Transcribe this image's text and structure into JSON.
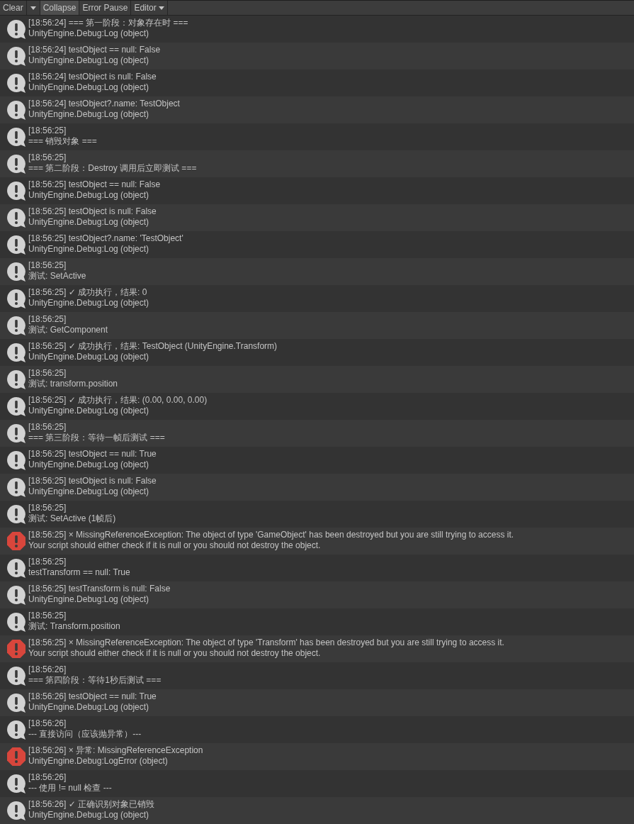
{
  "toolbar": {
    "items": [
      {
        "kind": "split",
        "label": "Clear"
      },
      {
        "kind": "toggle",
        "label": "Collapse",
        "on": true
      },
      {
        "kind": "toggle",
        "label": "Error Pause",
        "on": false
      },
      {
        "kind": "dropdown",
        "label": "Editor"
      }
    ]
  },
  "entries": [
    {
      "kind": "log",
      "line_1": "[18:56:24] === 第一阶段：对象存在时 ===",
      "line_2": "UnityEngine.Debug:Log (object)"
    },
    {
      "kind": "log",
      "line_1": "[18:56:24] testObject == null: False",
      "line_2": "UnityEngine.Debug:Log (object)"
    },
    {
      "kind": "log",
      "line_1": "[18:56:24] testObject is null: False",
      "line_2": "UnityEngine.Debug:Log (object)"
    },
    {
      "kind": "log",
      "line_1": "[18:56:24] testObject?.name: TestObject",
      "line_2": "UnityEngine.Debug:Log (object)"
    },
    {
      "kind": "log",
      "line_1": "[18:56:25]",
      "line_2": "=== 销毁对象 ==="
    },
    {
      "kind": "log",
      "line_1": "[18:56:25]",
      "line_2": "=== 第二阶段：Destroy 调用后立即测试 ==="
    },
    {
      "kind": "log",
      "line_1": "[18:56:25] testObject == null: False",
      "line_2": "UnityEngine.Debug:Log (object)"
    },
    {
      "kind": "log",
      "line_1": "[18:56:25] testObject is null: False",
      "line_2": "UnityEngine.Debug:Log (object)"
    },
    {
      "kind": "log",
      "line_1": "[18:56:25] testObject?.name: 'TestObject'",
      "line_2": "UnityEngine.Debug:Log (object)"
    },
    {
      "kind": "log",
      "line_1": "[18:56:25]",
      "line_2": "测试: SetActive"
    },
    {
      "kind": "log",
      "line_1": "[18:56:25] ✓ 成功执行，结果: 0",
      "line_2": "UnityEngine.Debug:Log (object)"
    },
    {
      "kind": "log",
      "line_1": "[18:56:25]",
      "line_2": "测试: GetComponent"
    },
    {
      "kind": "log",
      "line_1": "[18:56:25] ✓ 成功执行，结果: TestObject (UnityEngine.Transform)",
      "line_2": "UnityEngine.Debug:Log (object)"
    },
    {
      "kind": "log",
      "line_1": "[18:56:25]",
      "line_2": "测试: transform.position"
    },
    {
      "kind": "log",
      "line_1": "[18:56:25] ✓ 成功执行，结果: (0.00, 0.00, 0.00)",
      "line_2": "UnityEngine.Debug:Log (object)"
    },
    {
      "kind": "log",
      "line_1": "[18:56:25]",
      "line_2": "=== 第三阶段：等待一帧后测试 ==="
    },
    {
      "kind": "log",
      "line_1": "[18:56:25] testObject == null: True",
      "line_2": "UnityEngine.Debug:Log (object)"
    },
    {
      "kind": "log",
      "line_1": "[18:56:25] testObject is null: False",
      "line_2": "UnityEngine.Debug:Log (object)"
    },
    {
      "kind": "log",
      "line_1": "[18:56:25]",
      "line_2": "测试: SetActive (1帧后)"
    },
    {
      "kind": "error",
      "line_1": "[18:56:25] × MissingReferenceException: The object of type 'GameObject' has been destroyed but you are still trying to access it.",
      "line_2": "Your script should either check if it is null or you should not destroy the object."
    },
    {
      "kind": "log",
      "line_1": "[18:56:25]",
      "line_2": "testTransform == null: True"
    },
    {
      "kind": "log",
      "line_1": "[18:56:25] testTransform is null: False",
      "line_2": "UnityEngine.Debug:Log (object)"
    },
    {
      "kind": "log",
      "line_1": "[18:56:25]",
      "line_2": "测试: Transform.position"
    },
    {
      "kind": "error",
      "line_1": "[18:56:25] × MissingReferenceException: The object of type 'Transform' has been destroyed but you are still trying to access it.",
      "line_2": "Your script should either check if it is null or you should not destroy the object."
    },
    {
      "kind": "log",
      "line_1": "[18:56:26]",
      "line_2": "=== 第四阶段：等待1秒后测试 ==="
    },
    {
      "kind": "log",
      "line_1": "[18:56:26] testObject == null: True",
      "line_2": "UnityEngine.Debug:Log (object)"
    },
    {
      "kind": "log",
      "line_1": "[18:56:26]",
      "line_2": "--- 直接访问（应该抛异常）---"
    },
    {
      "kind": "error",
      "line_1": "[18:56:26] × 异常: MissingReferenceException",
      "line_2": "UnityEngine.Debug:LogError (object)"
    },
    {
      "kind": "log",
      "line_1": "[18:56:26]",
      "line_2": "--- 使用 != null 检查 ---"
    },
    {
      "kind": "log",
      "line_1": "[18:56:26] ✓ 正确识别对象已销毁",
      "line_2": "UnityEngine.Debug:Log (object)"
    }
  ]
}
